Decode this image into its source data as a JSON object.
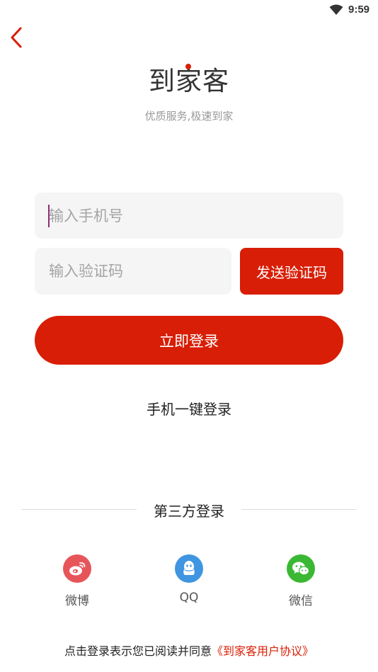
{
  "status_bar": {
    "time": "9:59"
  },
  "header": {
    "logo_text": "到家客",
    "slogan": "优质服务,极速到家"
  },
  "form": {
    "phone_placeholder": "输入手机号",
    "code_placeholder": "输入验证码",
    "send_code_label": "发送验证码",
    "login_label": "立即登录",
    "one_key_login_label": "手机一键登录"
  },
  "third_party": {
    "title": "第三方登录",
    "items": [
      {
        "label": "微博",
        "icon": "weibo-icon",
        "color": "#e6555a"
      },
      {
        "label": "QQ",
        "icon": "qq-icon",
        "color": "#3f95e0"
      },
      {
        "label": "微信",
        "icon": "wechat-icon",
        "color": "#3bb833"
      }
    ]
  },
  "agreement": {
    "prefix": "点击登录表示您已阅读并同意",
    "link": "《到家客用户协议》"
  },
  "colors": {
    "accent": "#d81e06",
    "field_bg": "#f5f5f5"
  }
}
